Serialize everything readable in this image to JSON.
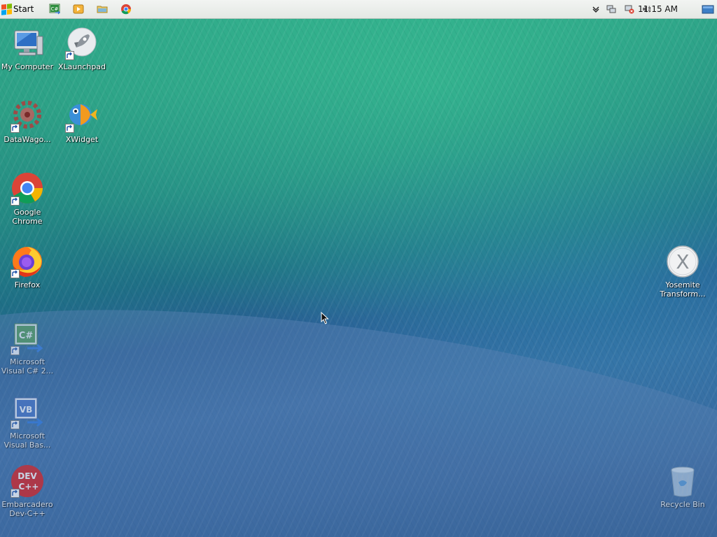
{
  "taskbar": {
    "start_label": "Start",
    "quick_launch": [
      {
        "icon": "csharp-icon"
      },
      {
        "icon": "media-player-icon"
      },
      {
        "icon": "folder-icon"
      },
      {
        "icon": "chrome-icon"
      }
    ],
    "tray": {
      "clock": "11:15 AM",
      "icons": [
        "chevron-down-icon",
        "network-icon",
        "network-error-icon",
        "volume-icon",
        "show-desktop-icon"
      ]
    }
  },
  "desktop": {
    "icons": [
      {
        "label": "My Computer",
        "icon": "computer-icon"
      },
      {
        "label": "XLaunchpad",
        "icon": "rocket-icon"
      },
      {
        "label": "DataWago...",
        "icon": "gear-icon"
      },
      {
        "label": "XWidget",
        "icon": "fish-icon"
      },
      {
        "label": "Google Chrome",
        "icon": "chrome-icon"
      },
      {
        "label": "Firefox",
        "icon": "firefox-icon"
      },
      {
        "label": "Microsoft Visual C# 2...",
        "icon": "csharp-icon"
      },
      {
        "label": "Microsoft Visual Bas...",
        "icon": "visual-basic-icon"
      },
      {
        "label": "Embarcadero Dev-C++",
        "icon": "devcpp-icon"
      },
      {
        "label": "Yosemite Transform...",
        "icon": "osx-x-icon"
      },
      {
        "label": "Recycle Bin",
        "icon": "recycle-bin-icon"
      }
    ]
  },
  "icon_texts": {
    "csharp": "C#",
    "vb": "VB",
    "dev": "DEV",
    "cpp": "C++",
    "x": "X"
  },
  "colors": {
    "taskbar_bg": "#e6eae6",
    "label_text": "#ffffff",
    "wave_green": "#2fa889",
    "wave_blue": "#3a69a0"
  }
}
